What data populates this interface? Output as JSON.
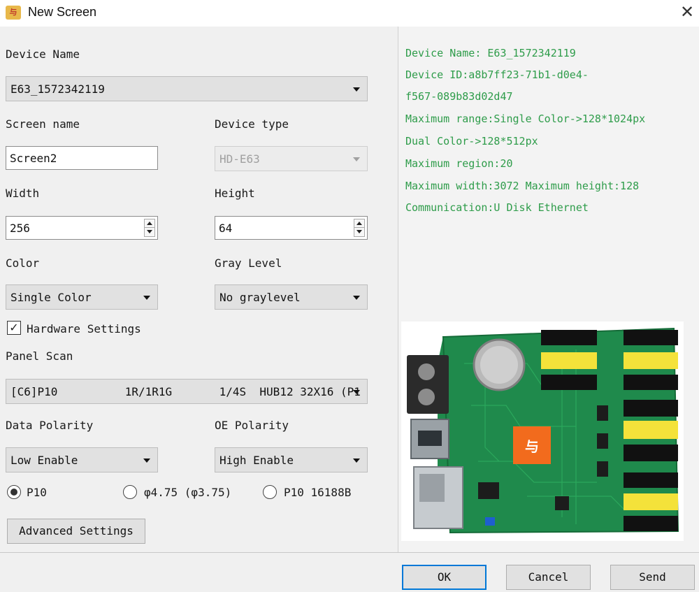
{
  "window": {
    "title": "New Screen",
    "icon": "app-logo-icon",
    "icon_text": "与",
    "close_glyph": "✕"
  },
  "form": {
    "device_name_label": "Device Name",
    "device_name_value": "E63_1572342119",
    "screen_name_label": "Screen name",
    "screen_name_value": "Screen2",
    "device_type_label": "Device type",
    "device_type_value": "HD-E63",
    "width_label": "Width",
    "width_value": "256",
    "height_label": "Height",
    "height_value": "64",
    "color_label": "Color",
    "color_value": "Single Color",
    "gray_level_label": "Gray Level",
    "gray_level_value": "No graylevel",
    "hardware_settings_label": "Hardware Settings",
    "hardware_settings_checked": true,
    "panel_scan_label": "Panel Scan",
    "panel_scan_value": "[C6]P10          1R/1R1G       1/4S  HUB12 32X16 (P1",
    "data_polarity_label": "Data Polarity",
    "data_polarity_value": "Low Enable",
    "oe_polarity_label": "OE Polarity",
    "oe_polarity_value": "High Enable",
    "radio_options": [
      {
        "label": "P10",
        "checked": true
      },
      {
        "label": "φ4.75 (φ3.75)",
        "checked": false
      },
      {
        "label": "P10 16188B",
        "checked": false
      }
    ],
    "advanced_settings_button": "Advanced Settings"
  },
  "info": {
    "lines": [
      "Device Name: E63_1572342119",
      "Device ID:a8b7ff23-71b1-d0e4-",
      "f567-089b83d02d47",
      "Maximum range:Single Color->128*1024px",
      "Dual Color->128*512px",
      "Maximum region:20",
      "Maximum width:3072 Maximum height:128",
      "Communication:U Disk  Ethernet"
    ],
    "text_color": "#2e9c4a",
    "board_chip_text": "与"
  },
  "buttons": {
    "ok": "OK",
    "cancel": "Cancel",
    "send": "Send"
  },
  "colors": {
    "accent": "#0078d7",
    "pcb_green": "#1f8a4c",
    "chip_orange": "#f26b1d",
    "header_yellow": "#f4e23a"
  }
}
